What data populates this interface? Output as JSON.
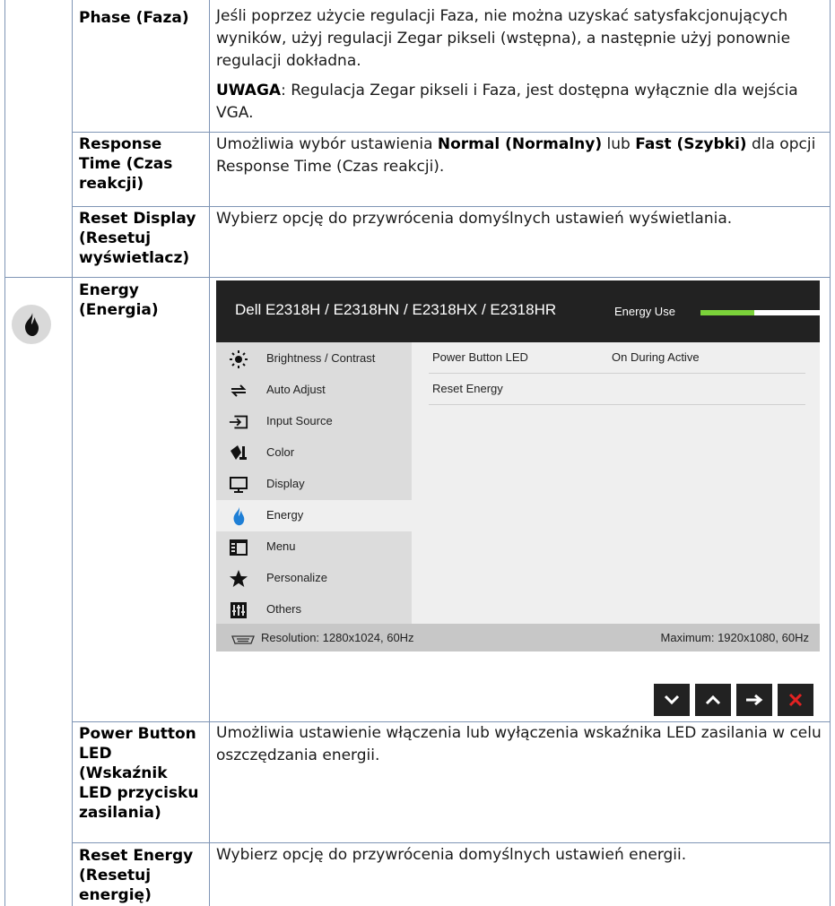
{
  "rows": {
    "phase": {
      "label": "Phase (Faza)",
      "desc": "Jeśli poprzez użycie regulacji Faza, nie można uzyskać satysfakcjonujących wyników, użyj regulacji Zegar pikseli (wstępna), a następnie użyj ponownie regulacji dokładna.",
      "note_label": "UWAGA",
      "note_text": ": Regulacja Zegar pikseli i Faza, jest dostępna wyłącznie dla wejścia VGA."
    },
    "response": {
      "label": "Response Time (Czas reakcji)",
      "desc_pre": "Umożliwia wybór ustawienia ",
      "opt_normal": "Normal (Normalny)",
      "desc_mid": " lub ",
      "opt_fast": "Fast (Szybki)",
      "desc_post": " dla opcji Response Time (Czas reakcji)."
    },
    "reset_display": {
      "label": "Reset Display (Resetuj wyświetlacz)",
      "desc": "Wybierz opcję do przywrócenia domyślnych ustawień wyświetlania."
    },
    "energy": {
      "label": "Energy (Energia)",
      "icon": "flame-icon"
    },
    "power_led": {
      "label": "Power Button LED (Wskaźnik LED przycisku zasilania)",
      "desc": "Umożliwia ustawienie włączenia lub wyłączenia wskaźnika LED zasilania w celu oszczędzania energii."
    },
    "reset_energy": {
      "label": "Reset Energy (Resetuj energię)",
      "desc": "Wybierz opcję do przywrócenia domyślnych ustawień energii."
    }
  },
  "osd": {
    "title": "Dell E2318H / E2318HN / E2318HX / E2318HR",
    "energy_use_label": "Energy Use",
    "energy_use_fraction": 0.45,
    "energy_color": "#7bd23a",
    "menu": [
      {
        "label": "Brightness / Contrast",
        "icon": "sun-icon"
      },
      {
        "label": "Auto Adjust",
        "icon": "auto-adjust-icon"
      },
      {
        "label": "Input Source",
        "icon": "input-source-icon"
      },
      {
        "label": "Color",
        "icon": "color-icon"
      },
      {
        "label": "Display",
        "icon": "display-icon"
      },
      {
        "label": "Energy",
        "icon": "energy-icon",
        "active": true
      },
      {
        "label": "Menu",
        "icon": "menu-icon"
      },
      {
        "label": "Personalize",
        "icon": "star-icon"
      },
      {
        "label": "Others",
        "icon": "others-icon"
      }
    ],
    "submenu": [
      {
        "label": "Power Button LED",
        "value": "On During Active"
      },
      {
        "label": "Reset Energy",
        "value": ""
      }
    ],
    "resolution": "Resolution: 1280x1024, 60Hz",
    "maximum": "Maximum: 1920x1080, 60Hz",
    "nav": [
      "down-icon",
      "up-icon",
      "right-arrow-icon",
      "close-icon"
    ]
  }
}
